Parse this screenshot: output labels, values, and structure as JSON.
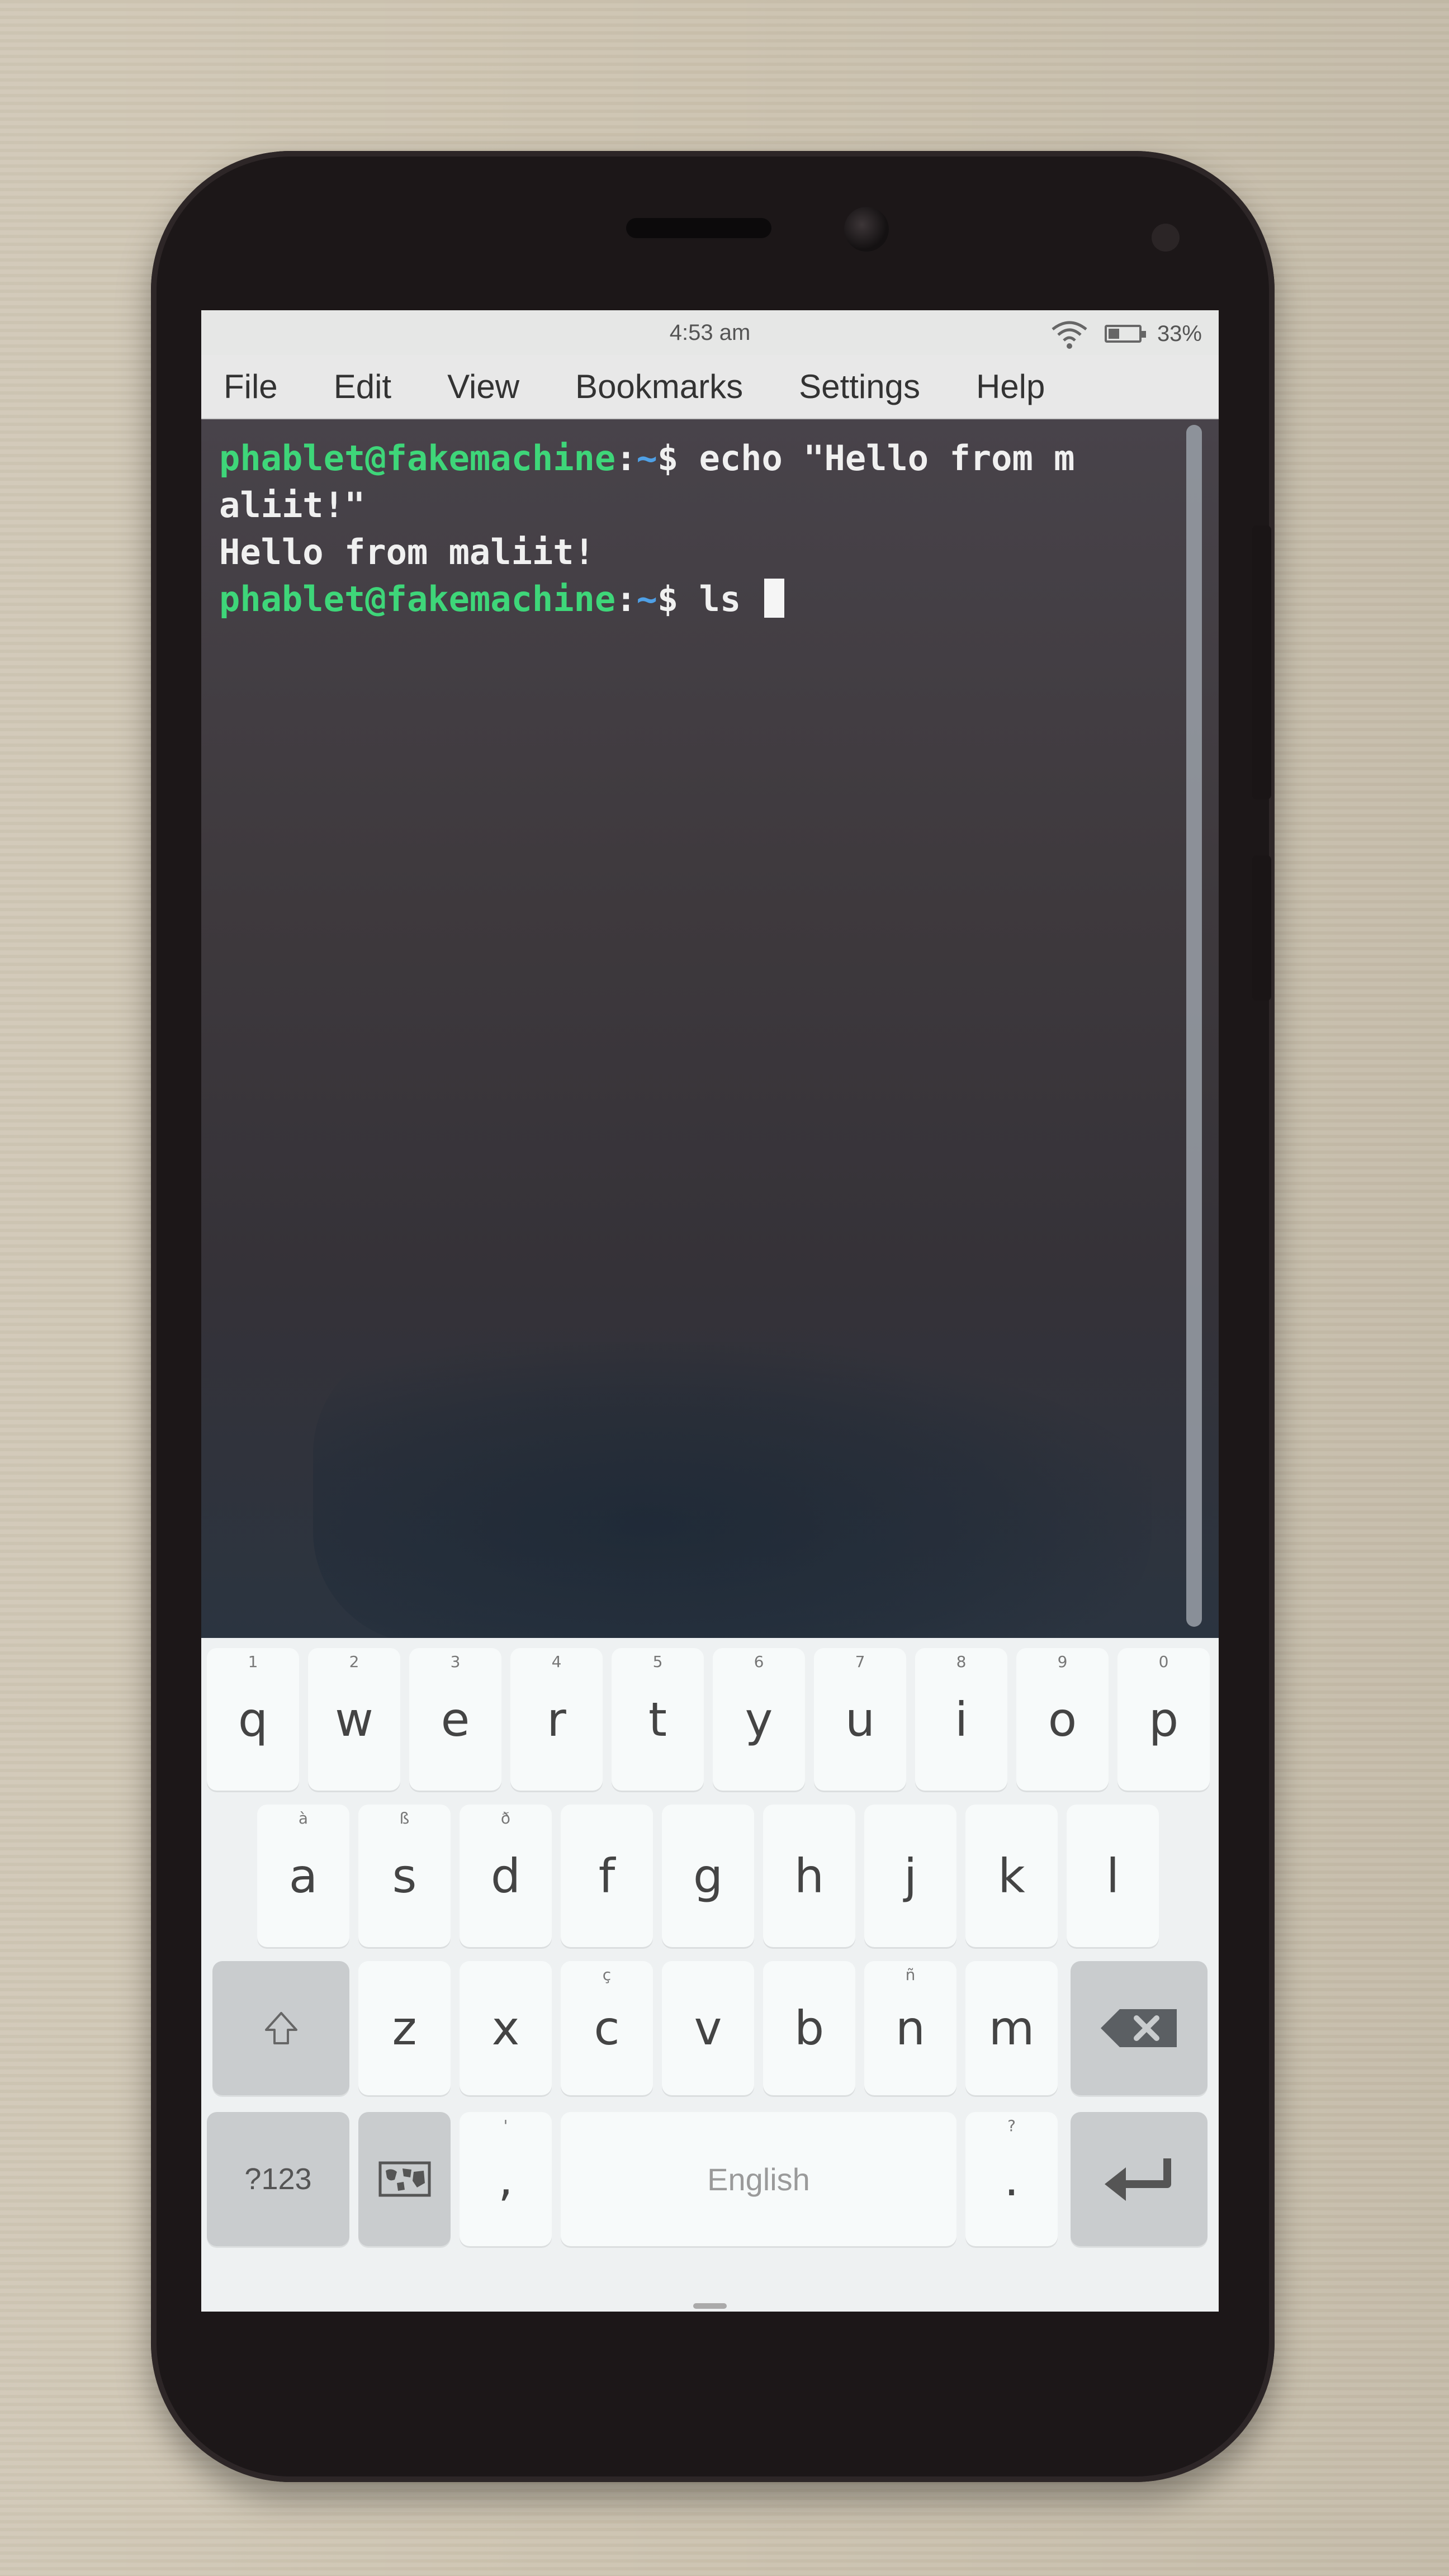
{
  "statusbar": {
    "time": "4:53 am",
    "battery_percent": "33%",
    "battery_level": 0.33,
    "icons": [
      "wifi-icon",
      "battery-icon"
    ]
  },
  "menubar": {
    "items": [
      "File",
      "Edit",
      "View",
      "Bookmarks",
      "Settings",
      "Help"
    ]
  },
  "terminal": {
    "prompt_user_host": "phablet@fakemachine",
    "prompt_sep": ":",
    "prompt_path": "~",
    "prompt_symbol": "$ ",
    "line1_command": "echo \"Hello from m",
    "line2_wrap": "aliit!\"",
    "line3_output": "Hello from maliit!",
    "line4_command": "ls ",
    "colors": {
      "user": "#3ed679",
      "path": "#4fa0e6",
      "text": "#f0f0f0",
      "background": "#3c373b"
    }
  },
  "keyboard": {
    "row1": [
      {
        "key": "q",
        "hint": "1"
      },
      {
        "key": "w",
        "hint": "2"
      },
      {
        "key": "e",
        "hint": "3"
      },
      {
        "key": "r",
        "hint": "4"
      },
      {
        "key": "t",
        "hint": "5"
      },
      {
        "key": "y",
        "hint": "6"
      },
      {
        "key": "u",
        "hint": "7"
      },
      {
        "key": "i",
        "hint": "8"
      },
      {
        "key": "o",
        "hint": "9"
      },
      {
        "key": "p",
        "hint": "0"
      }
    ],
    "row2": [
      {
        "key": "a",
        "hint": "à"
      },
      {
        "key": "s",
        "hint": "ß"
      },
      {
        "key": "d",
        "hint": "ð"
      },
      {
        "key": "f",
        "hint": ""
      },
      {
        "key": "g",
        "hint": ""
      },
      {
        "key": "h",
        "hint": ""
      },
      {
        "key": "j",
        "hint": ""
      },
      {
        "key": "k",
        "hint": ""
      },
      {
        "key": "l",
        "hint": ""
      }
    ],
    "row3": [
      {
        "key": "z",
        "hint": ""
      },
      {
        "key": "x",
        "hint": ""
      },
      {
        "key": "c",
        "hint": "ç"
      },
      {
        "key": "v",
        "hint": ""
      },
      {
        "key": "b",
        "hint": ""
      },
      {
        "key": "n",
        "hint": "ñ"
      },
      {
        "key": "m",
        "hint": ""
      }
    ],
    "shift_icon": "shift-icon",
    "backspace_icon": "backspace-icon",
    "symbols_label": "?123",
    "layout_icon": "keyboard-map-icon",
    "comma": {
      "key": ",",
      "hint": "'"
    },
    "space_label": "English",
    "period": {
      "key": ".",
      "hint": "?"
    },
    "enter_icon": "enter-icon"
  }
}
